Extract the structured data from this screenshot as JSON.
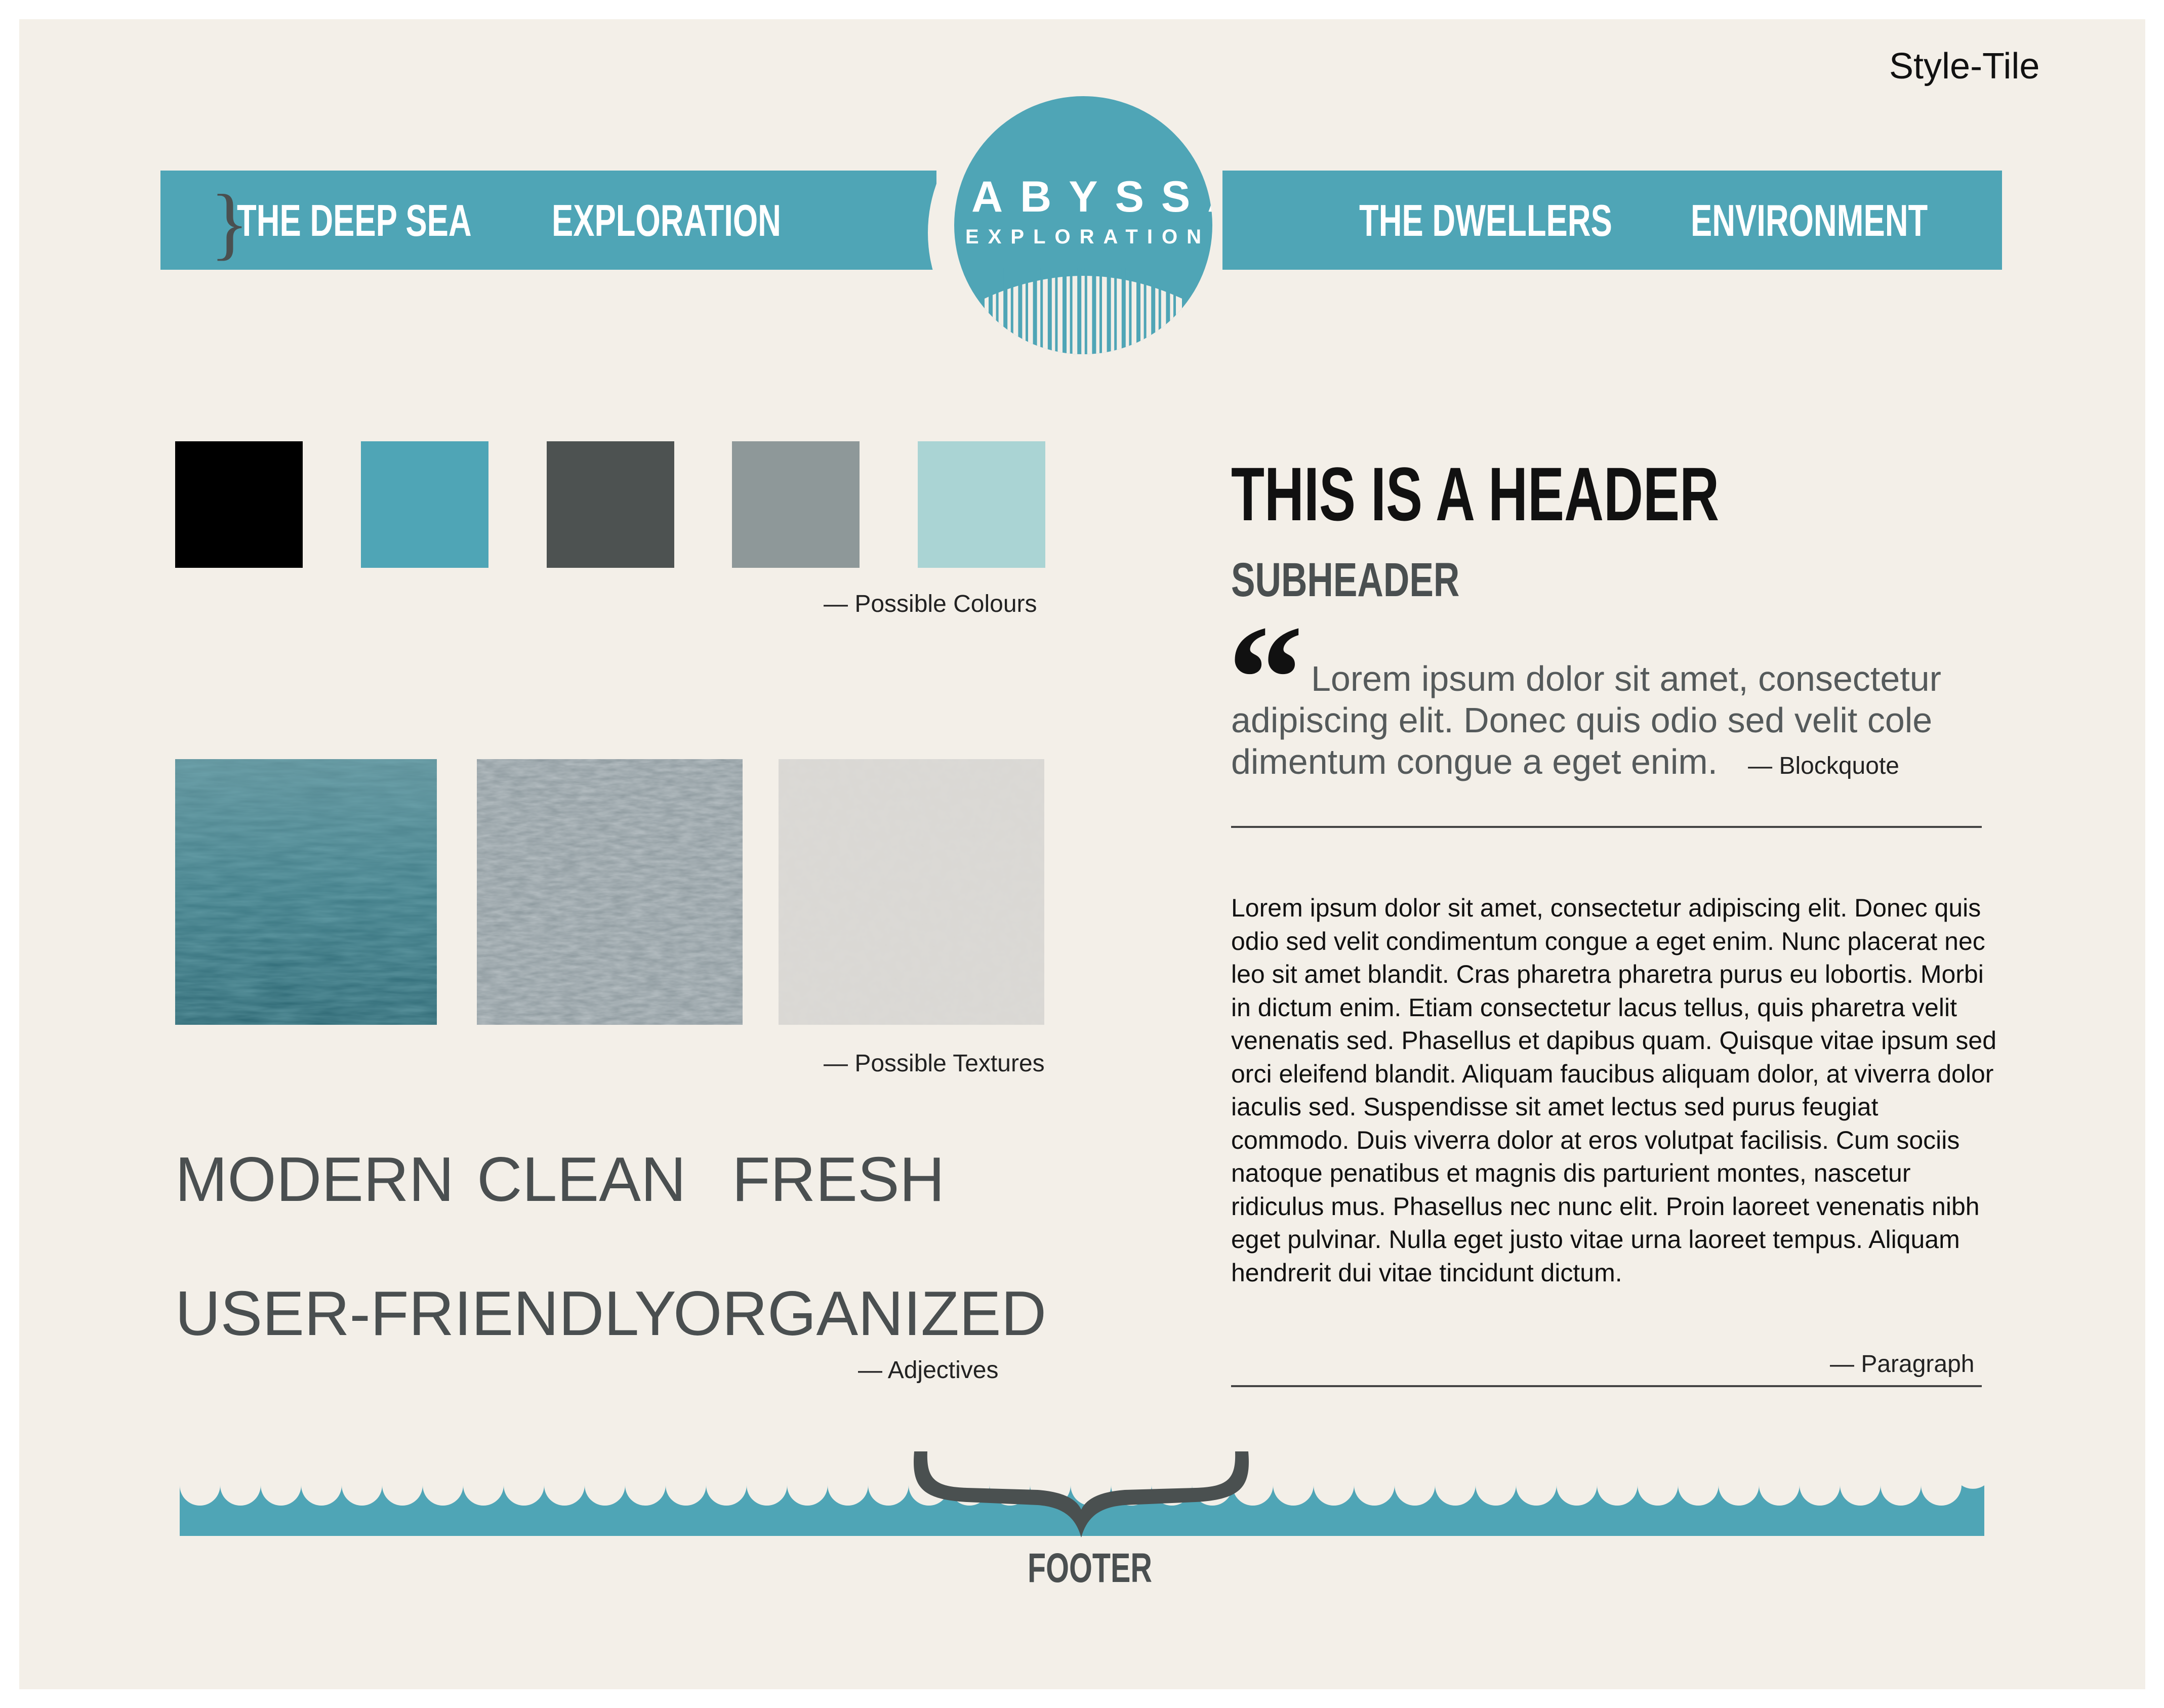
{
  "style_tile": "Style-Tile",
  "nav": {
    "items": [
      "THE DEEP SEA",
      "EXPLORATION",
      "THE DWELLERS",
      "ENVIRONMENT"
    ],
    "brace": "}"
  },
  "logo": {
    "title": "ABYSSAL",
    "subtitle": "EXPLORATION"
  },
  "colors": {
    "swatches": [
      "#000000",
      "#4fa5b6",
      "#4d5251",
      "#8e9899",
      "#aad4d4"
    ],
    "caption": "— Possible Colours"
  },
  "textures": {
    "caption": "— Possible Textures",
    "names": [
      "water-surface-texture",
      "gray-sea-texture",
      "light-paper-texture"
    ]
  },
  "adjectives": {
    "words": [
      "MODERN",
      "CLEAN",
      "FRESH",
      "USER-FRIENDLY",
      "ORGANIZED"
    ],
    "caption": "— Adjectives"
  },
  "typography": {
    "header": "THIS IS A HEADER",
    "subheader": "SUBHEADER",
    "quote_mark": "“",
    "blockquote": "Lorem ipsum dolor sit amet, consectetur adipiscing elit. Donec quis odio sed velit cole dimentum congue a eget enim.",
    "blockquote_caption": "— Blockquote",
    "paragraph": "Lorem ipsum dolor sit amet, consectetur adipiscing elit. Donec quis odio sed velit condimentum congue a eget enim. Nunc placerat nec leo sit amet blandit. Cras pharetra pharetra purus eu lobortis. Morbi in dictum enim. Etiam consectetur lacus tellus, quis pharetra velit venenatis sed. Phasellus et dapibus quam. Quisque vitae ipsum sed orci eleifend blandit. Aliquam faucibus aliquam dolor, at viverra dolor iaculis sed. Suspendisse sit amet lectus sed purus feugiat commodo. Duis viverra dolor at eros volutpat facilisis. Cum sociis natoque penatibus et magnis dis parturient montes, nascetur ridiculus mus. Phasellus nec nunc elit. Proin laoreet venenatis nibh eget pulvinar. Nulla eget justo vitae urna laoreet tempus. Aliquam hendrerit dui vitae tincidunt dictum.",
    "paragraph_caption": "— Paragraph"
  },
  "footer": {
    "label": "FOOTER"
  }
}
